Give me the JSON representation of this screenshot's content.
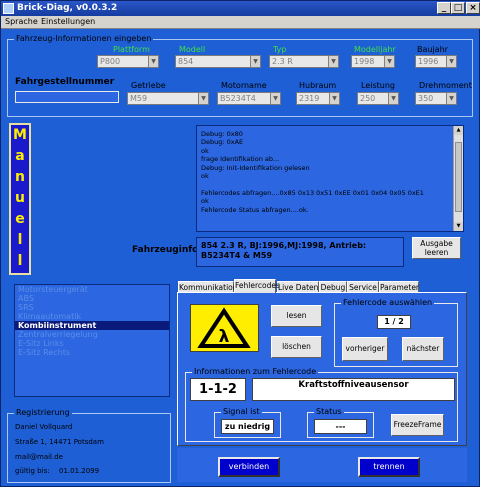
{
  "window": {
    "title": "Brick-Diag, v0.0.3.2"
  },
  "menu": [
    "Sprache",
    "Einstellungen"
  ],
  "vehicle_info": {
    "group_label": "Fahrzeug-Informationen  eingeben",
    "plattform": {
      "label": "Plattform",
      "value": "P800"
    },
    "modell": {
      "label": "Modell",
      "value": "854"
    },
    "typ": {
      "label": "Typ",
      "value": "2.3 R"
    },
    "modelljahr": {
      "label": "Modelljahr",
      "value": "1998"
    },
    "baujahr": {
      "label": "Baujahr",
      "value": "1996"
    },
    "fahrgestellnummer_label": "Fahrgestellnummer",
    "fahrgestellnummer_value": "",
    "getriebe": {
      "label": "Getriebe",
      "value": "M59"
    },
    "motorname": {
      "label": "Motorname",
      "value": "B5234T4"
    },
    "hubraum": {
      "label": "Hubraum",
      "value": "2319"
    },
    "leistung": {
      "label": "Leistung",
      "value": "250"
    },
    "drehmoment": {
      "label": "Drehmoment",
      "value": "350"
    }
  },
  "mode_banner": [
    "M",
    "a",
    "n",
    "u",
    "e",
    "l",
    "l"
  ],
  "debug_lines": [
    "Debug: 0x80",
    "Debug: 0xAE",
    "ok",
    "frage Identifikation ab...",
    "Debug: Init-Identifikation gelesen",
    "ok",
    "",
    "Fehlercodes abfragen....0x85 0x13 0x51 0xEE 0x01 0x04 0x05 0xE1",
    "ok",
    "Fehlercode Status abfragen....ok."
  ],
  "fahrzeuginfo": {
    "label": "Fahrzeuginfo",
    "text": "854 2.3 R, BJ:1996,MJ:1998, Antrieb: B5234T4 & M59",
    "ausgabe_button": "Ausgabe leeren"
  },
  "steuergeraete": {
    "items": [
      "Motorsteuergerät",
      "ABS",
      "SRS",
      "Klimaautomatik",
      "Kombiinstrument",
      "Zentralverriegelung",
      "E-Sitz Links",
      "E-Sitz Rechts"
    ],
    "selected_index": 4
  },
  "registrierung": {
    "label": "Registrierung",
    "name": "Daniel Vollquard",
    "address": "Straße 1, 14471 Potsdam",
    "email": "mail@mail.de",
    "valid_label": "gültig bis:",
    "valid_date": "01.01.2099"
  },
  "tabs": {
    "items": [
      "Kommunikation",
      "Fehlercodes",
      "Live Daten",
      "Debug",
      "Service",
      "Parameter"
    ],
    "active_index": 1
  },
  "fehlercodes": {
    "lesen": "lesen",
    "loeschen": "löschen",
    "auswaehlen_label": "Fehlercode auswählen",
    "counter": "1 / 2",
    "vorheriger": "vorheriger",
    "naechster": "nächster",
    "info_label": "Informationen zum Fehlercode",
    "code": "1-1-2",
    "description": "Kraftstoffniveausensor",
    "signal_label": "Signal ist",
    "signal_value": "zu niedrig",
    "status_label": "Status",
    "status_value": "---",
    "freezeframe": "FreezeFrame"
  },
  "connect": {
    "verbinden": "verbinden",
    "trennen": "trennen"
  },
  "colors": {
    "background": "#1e5fd6",
    "panel": "#2c66e0",
    "accent_green": "#40e040",
    "banner_letters": "#ffee00",
    "connect_buttons": "#0000cc"
  }
}
